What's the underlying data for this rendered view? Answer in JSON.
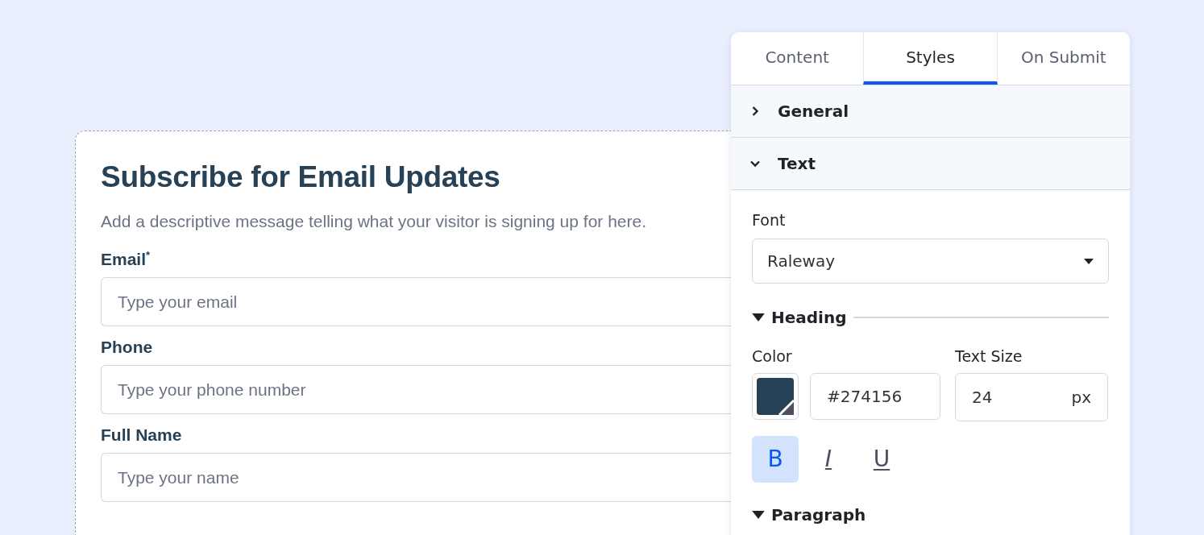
{
  "form": {
    "title": "Subscribe for Email Updates",
    "description": "Add a descriptive message telling what your visitor is signing up for here.",
    "fields": [
      {
        "label": "Email$^{*}$",
        "placeholder": "Type your email"
      },
      {
        "label": "Phone",
        "placeholder": "Type your phone number"
      },
      {
        "label": "Full Name",
        "placeholder": "Type your name"
      }
    ]
  },
  "panel": {
    "tabs": [
      {
        "label": "Content",
        "selected": false
      },
      {
        "label": "Styles",
        "selected": true
      },
      {
        "label": "On Submit",
        "selected": false
      }
    ],
    "sections": [
      {
        "label": "General",
        "expanded": false
      },
      {
        "label": "Text",
        "expanded": true
      }
    ],
    "font": {
      "label": "Font",
      "value": "Raleway"
    },
    "heading": {
      "label": "Heading",
      "expanded": true,
      "color_label": "Color",
      "color": "#274156",
      "color_value": "#274156",
      "size_label": "Text Size",
      "size_value": "24",
      "size_unit": "px",
      "format_buttons": [
        {
          "kind": "bold",
          "label": "B",
          "selected": true
        },
        {
          "kind": "italic",
          "label": "I",
          "selected": false
        },
        {
          "kind": "underline",
          "label": "U",
          "selected": false
        }
      ]
    },
    "paragraph": {
      "label": "Paragraph",
      "expanded": true
    }
  }
}
